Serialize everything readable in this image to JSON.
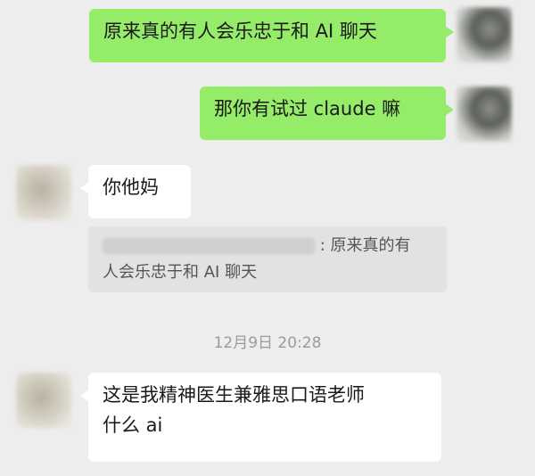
{
  "messages": [
    {
      "text": "原来真的有人会乐忠于和 AI 聊天"
    },
    {
      "text": "那你有试过 claude 嘛"
    },
    {
      "text": "你他妈"
    },
    {
      "text_line1": "这是我精神医生兼雅思口语老师",
      "text_line2": "什么 ai"
    }
  ],
  "quote": {
    "text_line1": "原来真的有",
    "text_line2": "人会乐忠于和 AI 聊天"
  },
  "timestamp": "12月9日 20:28"
}
